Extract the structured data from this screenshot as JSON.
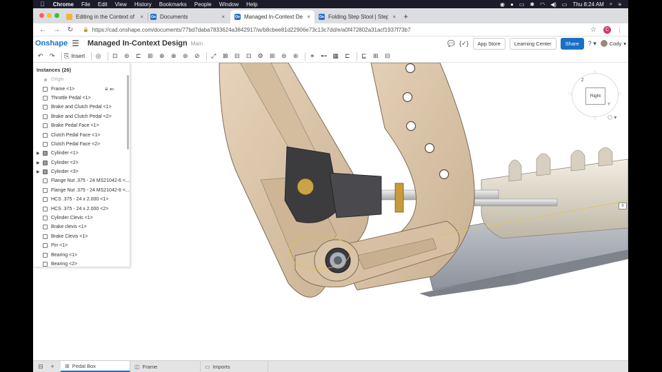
{
  "menubar": {
    "app": "Chrome",
    "items": [
      "File",
      "Edit",
      "View",
      "History",
      "Bookmarks",
      "People",
      "Window",
      "Help"
    ],
    "clock": "Thu 8:24 AM"
  },
  "tabs": [
    {
      "title": "Editing in the Context of the A",
      "favicon": "edit"
    },
    {
      "title": "Documents",
      "favicon": "On"
    },
    {
      "title": "Managed In-Context Design |",
      "favicon": "On"
    },
    {
      "title": "Folding Step Stool | Step Sto",
      "favicon": "On"
    }
  ],
  "address": {
    "url": "https://cad.onshape.com/documents/77bd7daba7833624a3842917/w/b8cbee81d22906e73c13c7dd/e/a0f472802a31acf1937f73b7",
    "profile_initial": "C"
  },
  "header": {
    "logo": "Onshape",
    "doc_title": "Managed In-Context Design",
    "branch": "Main",
    "app_store": "App Store",
    "learning_center": "Learning Center",
    "share": "Share",
    "user": "Cody"
  },
  "toolbar": {
    "insert_label": "Insert"
  },
  "panel": {
    "title": "Instances (26)",
    "items": [
      {
        "label": "Origin",
        "kind": "origin"
      },
      {
        "label": "Frame <1>",
        "kind": "part",
        "controls": "≡ ⇐"
      },
      {
        "label": "Throttle Pedal <1>",
        "kind": "part"
      },
      {
        "label": "Brake and Clutch Pedal <1>",
        "kind": "part"
      },
      {
        "label": "Brake and Clutch Pedal <2>",
        "kind": "part"
      },
      {
        "label": "Brake Pedal Face <1>",
        "kind": "part"
      },
      {
        "label": "Clutch Pedal Face <1>",
        "kind": "part"
      },
      {
        "label": "Clutch Pedal Face <2>",
        "kind": "part"
      },
      {
        "label": "Cylinder <1>",
        "kind": "assembly"
      },
      {
        "label": "Cylinder <2>",
        "kind": "assembly"
      },
      {
        "label": "Cylinder <3>",
        "kind": "assembly"
      },
      {
        "label": "Flange Nut .375 - 24 MS21042-6 <...",
        "kind": "part"
      },
      {
        "label": "Flange Nut .375 - 24 MS21042-6 <...",
        "kind": "part"
      },
      {
        "label": "HCS .375 - 24 x 2.000 <1>",
        "kind": "part"
      },
      {
        "label": "HCS .375 - 24 x 2.000 <2>",
        "kind": "part"
      },
      {
        "label": "Cylinder Clevis <1>",
        "kind": "part"
      },
      {
        "label": "Brake clevis <1>",
        "kind": "part"
      },
      {
        "label": "Brake Clevis <1>",
        "kind": "part"
      },
      {
        "label": "Pin <1>",
        "kind": "part"
      },
      {
        "label": "Bearing <1>",
        "kind": "part"
      },
      {
        "label": "Bearing <2>",
        "kind": "part"
      }
    ]
  },
  "viewcube": {
    "face_label": "Right",
    "axis_z": "Z",
    "axis_y": "Y"
  },
  "bottom_tabs": [
    {
      "label": "Pedal Box",
      "active": true
    },
    {
      "label": "Frame",
      "active": false
    },
    {
      "label": "Imports",
      "active": false
    }
  ],
  "colors": {
    "onshape_blue": "#1a6fc4",
    "pedal_tan": "#d8c2a6",
    "metal_gray": "#a5a9b2"
  }
}
